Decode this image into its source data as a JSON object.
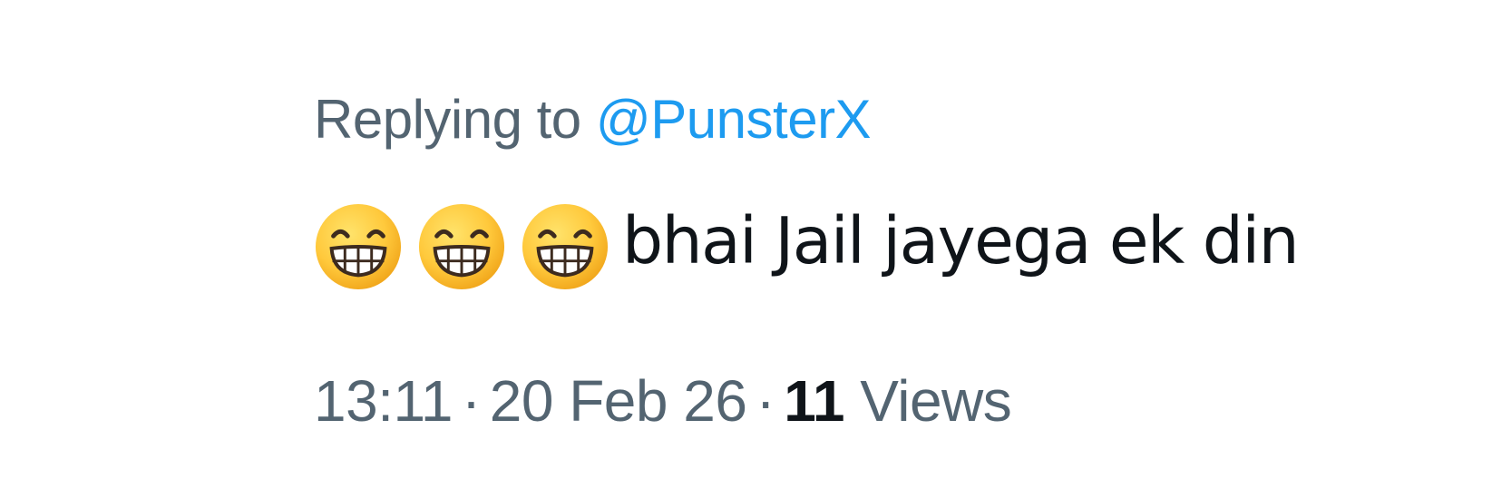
{
  "reply": {
    "prefix": "Replying to",
    "handle": "@PunsterX"
  },
  "tweet": {
    "emojis": [
      "grinning-face-with-smiling-eyes-icon",
      "grinning-face-with-smiling-eyes-icon",
      "grinning-face-with-smiling-eyes-icon"
    ],
    "text": "bhai Jail jayega ek din"
  },
  "meta": {
    "time": "13:11",
    "separator": "·",
    "date": "20 Feb 26",
    "view_count": "11",
    "views_label": "Views"
  },
  "colors": {
    "secondary_text": "#536471",
    "link": "#1d9bf0",
    "primary_text": "#0f1419",
    "emoji_face": "#ffc83d",
    "emoji_outline": "#e8a317"
  }
}
